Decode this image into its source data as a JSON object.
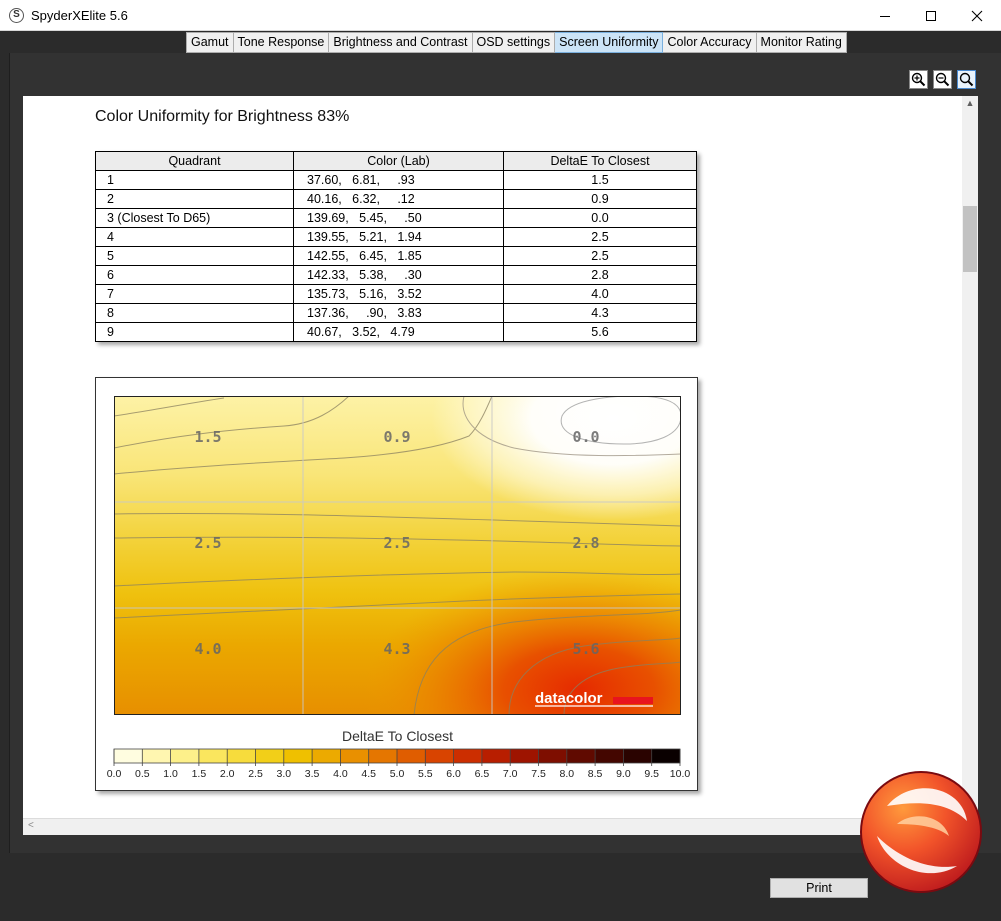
{
  "window": {
    "title": "SpyderXElite 5.6",
    "app_icon_glyph": "S",
    "minimize_glyph": "—",
    "maximize_glyph": "☐",
    "close_glyph": "✕"
  },
  "tabs": [
    {
      "label": "Gamut",
      "active": false
    },
    {
      "label": "Tone Response",
      "active": false
    },
    {
      "label": "Brightness and Contrast",
      "active": false
    },
    {
      "label": "OSD settings",
      "active": false
    },
    {
      "label": "Screen Uniformity",
      "active": true
    },
    {
      "label": "Color Accuracy",
      "active": false
    },
    {
      "label": "Monitor Rating",
      "active": false
    }
  ],
  "zoom_controls": [
    "zoom-in-icon",
    "zoom-out-icon",
    "zoom-fit-icon"
  ],
  "report": {
    "title": "Color Uniformity for Brightness 83%",
    "table": {
      "headers": [
        "Quadrant",
        "Color (Lab)",
        "DeltaE To Closest"
      ],
      "rows": [
        [
          "1",
          "37.60,   6.81,     .93",
          "1.5"
        ],
        [
          "2",
          "40.16,   6.32,     .12",
          "0.9"
        ],
        [
          "3 (Closest To D65)",
          "139.69,   5.45,     .50",
          "0.0"
        ],
        [
          "4",
          "139.55,   5.21,   1.94",
          "2.5"
        ],
        [
          "5",
          "142.55,   6.45,   1.85",
          "2.5"
        ],
        [
          "6",
          "142.33,   5.38,     .30",
          "2.8"
        ],
        [
          "7",
          "135.73,   5.16,   3.52",
          "4.0"
        ],
        [
          "8",
          "137.36,     .90,   3.83",
          "4.3"
        ],
        [
          "9",
          "40.67,   3.52,   4.79",
          "5.6"
        ]
      ]
    },
    "uniformity_map": {
      "quadrant_labels": [
        "1.5",
        "0.9",
        "0.0",
        "2.5",
        "2.5",
        "2.8",
        "4.0",
        "4.3",
        "5.6"
      ],
      "brand": "datacolor",
      "brand_color": "#e8141e",
      "legend_title": "DeltaE To Closest",
      "legend_ticks": [
        "0.0",
        "0.5",
        "1.0",
        "1.5",
        "2.0",
        "2.5",
        "3.0",
        "3.5",
        "4.0",
        "4.5",
        "5.0",
        "5.5",
        "6.0",
        "6.5",
        "7.0",
        "7.5",
        "8.0",
        "8.5",
        "9.0",
        "9.5",
        "10.0"
      ],
      "legend_colors": [
        "#ffffff",
        "#fffde0",
        "#fff6b0",
        "#fdf08a",
        "#fae65e",
        "#f7dc3c",
        "#f2cf18",
        "#efc000",
        "#ecaa00",
        "#e99000",
        "#e57600",
        "#e05d00",
        "#d94400",
        "#cc2e00",
        "#b81e00",
        "#9e1400",
        "#7e0e00",
        "#600a00",
        "#440600",
        "#2a0300",
        "#0a0000"
      ]
    }
  },
  "footer": {
    "print_label": "Print"
  }
}
